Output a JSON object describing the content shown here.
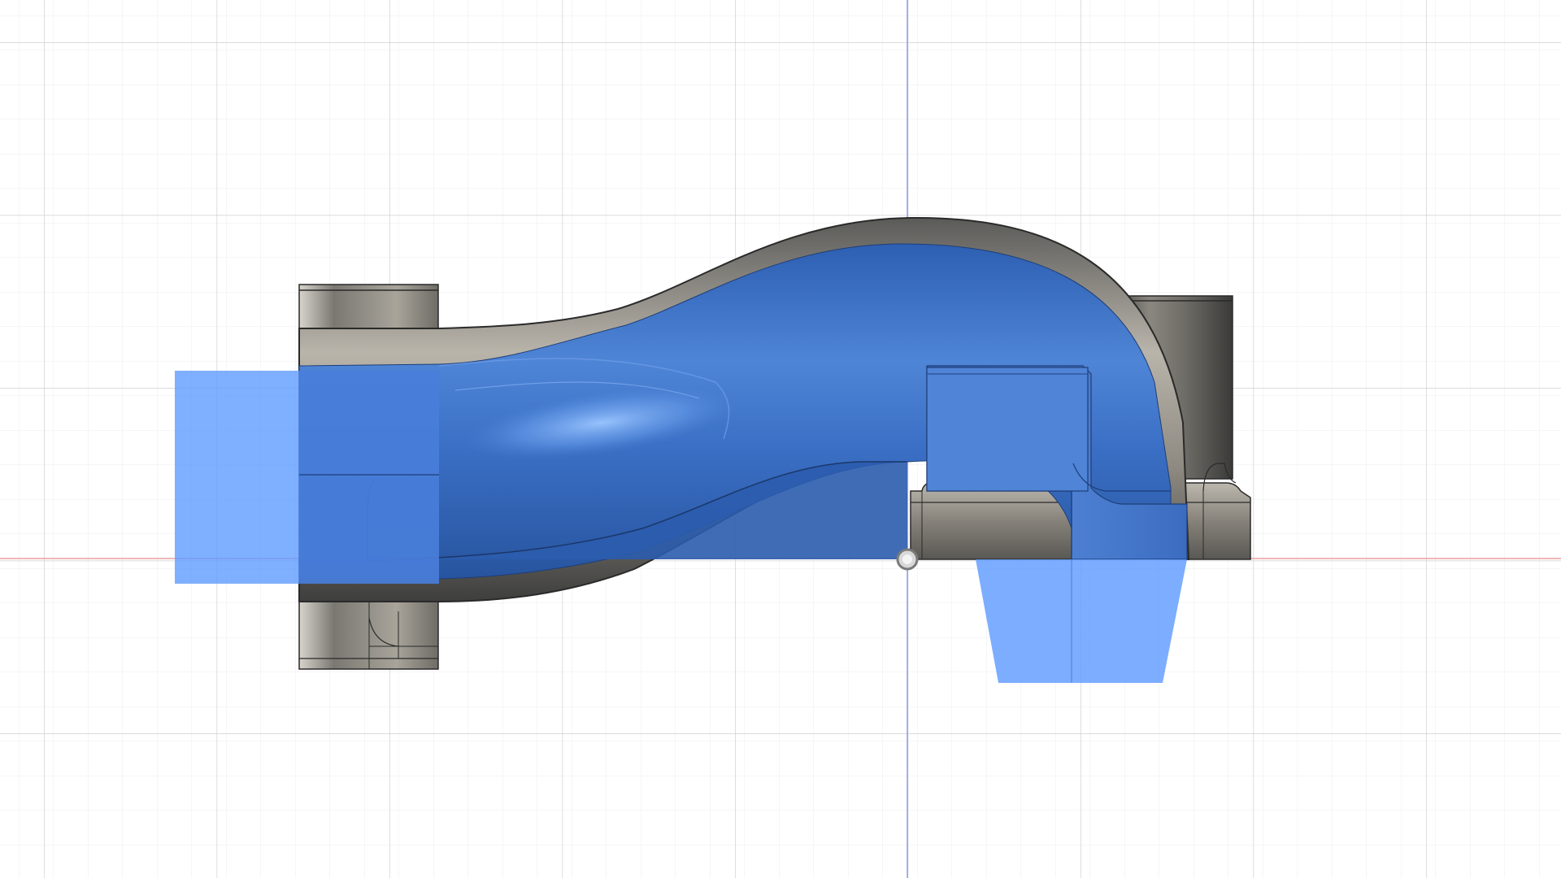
{
  "viewport": {
    "background_color": "#ffffff",
    "grid": {
      "visible": true,
      "minor_color": "#ececec",
      "major_color": "#cfcfcf"
    },
    "axes": {
      "horizontal_color": "#e8a0a0",
      "vertical_color": "#8fa0e6"
    },
    "origin_marker_icon": "origin-circle-icon"
  },
  "model": {
    "body_color": "#3f74c9",
    "selection_color": "#5f9bff",
    "shell_color": "#8e8e8e",
    "inlet_flange_icon": "flange-block-icon",
    "outlet_boss_icon": "cylinder-boss-icon"
  }
}
